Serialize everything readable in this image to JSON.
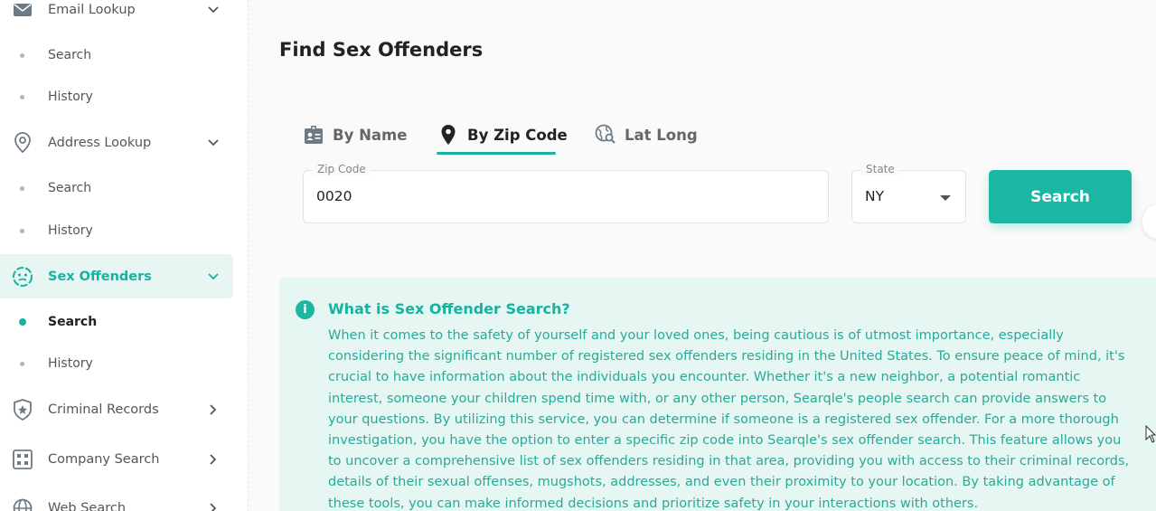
{
  "sidebar": {
    "email_lookup": {
      "label": "Email Lookup",
      "children": [
        "Search",
        "History"
      ]
    },
    "address_lookup": {
      "label": "Address Lookup",
      "children": [
        "Search",
        "History"
      ]
    },
    "sex_offenders": {
      "label": "Sex Offenders",
      "children": [
        "Search",
        "History"
      ]
    },
    "criminal_records": {
      "label": "Criminal Records"
    },
    "company_search": {
      "label": "Company Search"
    },
    "web_search": {
      "label": "Web Search"
    }
  },
  "page": {
    "title": "Find Sex Offenders"
  },
  "tabs": [
    {
      "label": "By Name",
      "icon": "id-badge-icon",
      "active": false
    },
    {
      "label": "By Zip Code",
      "icon": "map-pin-icon",
      "active": true
    },
    {
      "label": "Lat Long",
      "icon": "globe-search-icon",
      "active": false
    }
  ],
  "form": {
    "zip_label": "Zip Code",
    "zip_value": "0020",
    "state_label": "State",
    "state_value": "NY",
    "search_button": "Search"
  },
  "info": {
    "title": "What is Sex Offender Search?",
    "body": "When it comes to the safety of yourself and your loved ones, being cautious is of utmost importance, especially considering the significant number of registered sex offenders residing in the United States. To ensure peace of mind, it's crucial to have information about the individuals you encounter. Whether it's a new neighbor, a potential romantic interest, someone your children spend time with, or any other person, Searqle's people search can provide answers to your questions. By utilizing this service, you can determine if someone is a registered sex offender. For a more thorough investigation, you have the option to enter a specific zip code into Searqle's sex offender search. This feature allows you to uncover a comprehensive list of sex offenders residing in that area, providing you with access to their criminal records, details of their sexual offenses, mugshots, addresses, and even their proximity to your location. By taking advantage of these tools, you can make informed decisions and prioritize safety in your interactions with others."
  },
  "colors": {
    "accent": "#1cb7a3",
    "accent_bg": "#e6f6f3",
    "active_nav_bg": "#e7f5f3"
  }
}
